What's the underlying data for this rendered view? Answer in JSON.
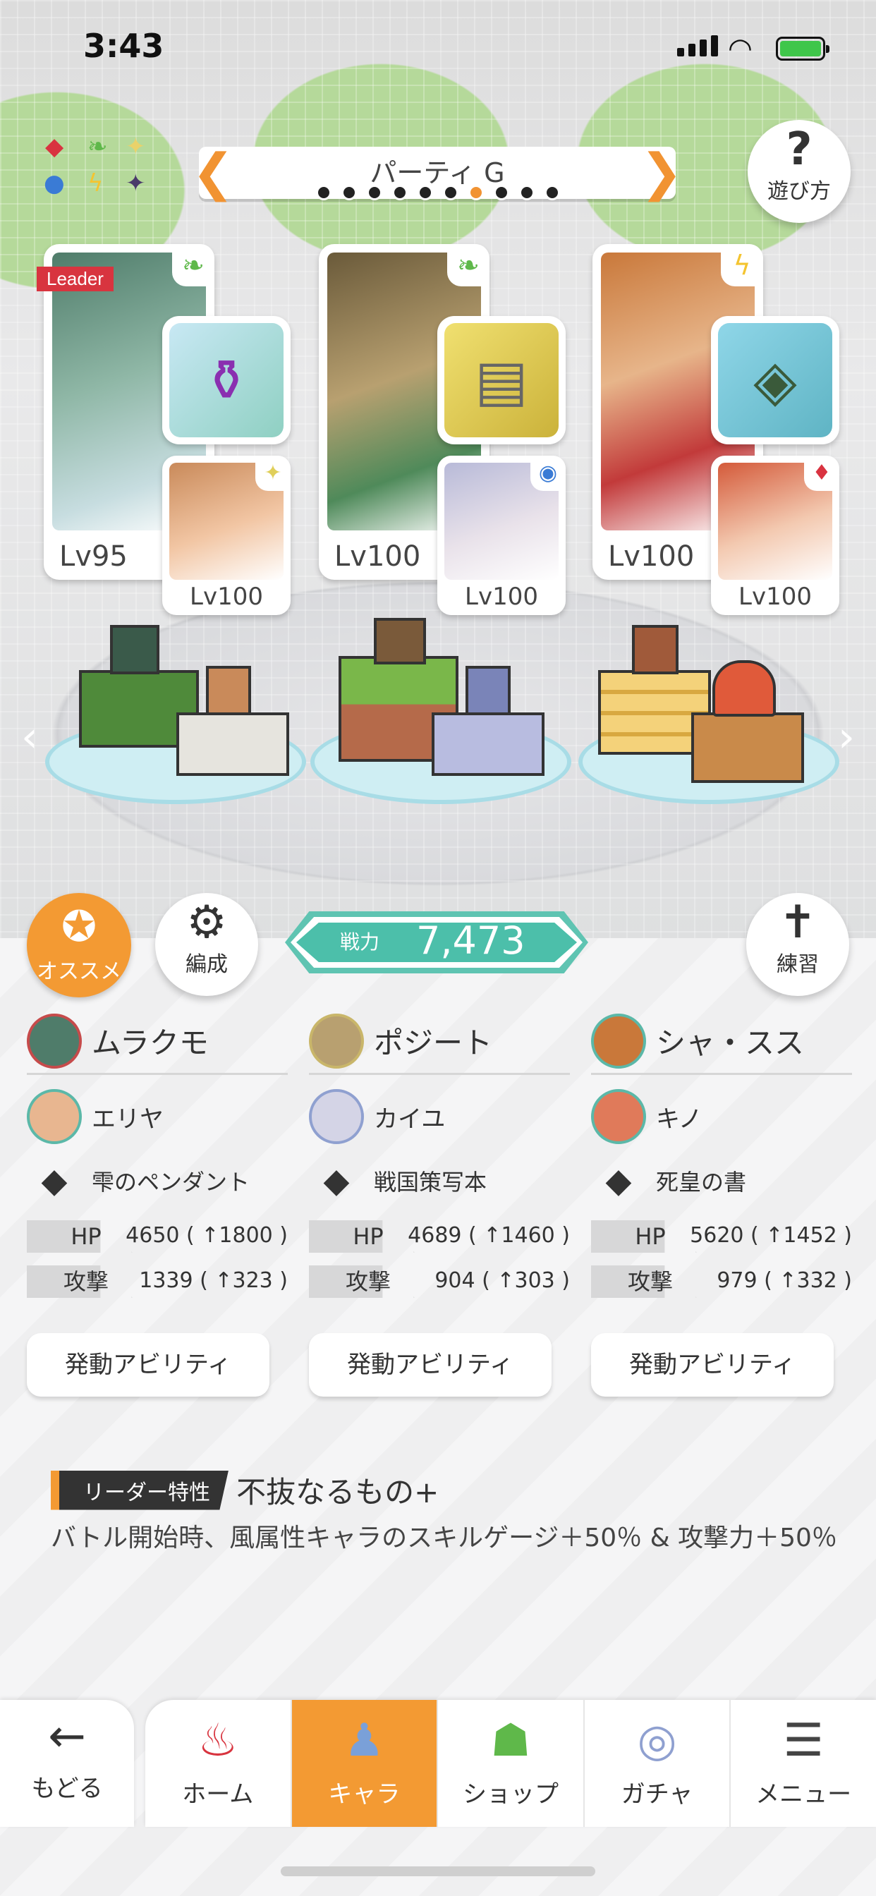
{
  "status_bar": {
    "time": "3:43"
  },
  "header": {
    "party_name": "パーティ G",
    "party_dot_count": 10,
    "party_active_index": 6,
    "help_label": "遊び方"
  },
  "lineup": {
    "leader_tag": "Leader",
    "slots": [
      {
        "main_level": "Lv95",
        "main_element_icon": "leaf-icon",
        "sub_level": "Lv100",
        "sub_element_icon": "sparkle-icon",
        "equip_icon": "potion-icon"
      },
      {
        "main_level": "Lv100",
        "main_element_icon": "leaf-icon",
        "sub_level": "Lv100",
        "sub_element_icon": "blue-orb-icon",
        "equip_icon": "scroll-icon"
      },
      {
        "main_level": "Lv100",
        "main_element_icon": "lightning-icon",
        "sub_level": "Lv100",
        "sub_element_icon": "red-diamonds-icon",
        "equip_icon": "book-icon"
      }
    ]
  },
  "controls": {
    "recommend_label": "オススメ",
    "formation_label": "編成",
    "practice_label": "練習",
    "power_label": "戦力",
    "power_value": "7,473"
  },
  "stats_labels": {
    "hp": "HP",
    "atk": "攻撃",
    "ability_button": "発動アビリティ"
  },
  "columns": [
    {
      "main_name": "ムラクモ",
      "sub_name": "エリヤ",
      "equip_name": "雫のペンダント",
      "hp": "4650 ( ↑1800 )",
      "atk": "1339 ( ↑323 )"
    },
    {
      "main_name": "ポジート",
      "sub_name": "カイユ",
      "equip_name": "戦国策写本",
      "hp": "4689 ( ↑1460 )",
      "atk": "904 ( ↑303 )"
    },
    {
      "main_name": "シャ・スス",
      "sub_name": "キノ",
      "equip_name": "死皇の書",
      "hp": "5620 ( ↑1452 )",
      "atk": "979 ( ↑332 )"
    }
  ],
  "leader_trait": {
    "tag": "リーダー特性",
    "name": "不抜なるもの+",
    "description": "バトル開始時、風属性キャラのスキルゲージ＋50％ & 攻撃力＋50％"
  },
  "bottom_nav": {
    "back_label": "もどる",
    "tabs": [
      {
        "label": "ホーム",
        "icon": "home-icon"
      },
      {
        "label": "キャラ",
        "icon": "chara-icon",
        "active": true
      },
      {
        "label": "ショップ",
        "icon": "shop-icon"
      },
      {
        "label": "ガチャ",
        "icon": "gacha-icon"
      },
      {
        "label": "メニュー",
        "icon": "menu-icon"
      }
    ]
  },
  "colors": {
    "accent_orange": "#f39a33",
    "power_teal": "#4cbfaa",
    "leader_red": "#d8343f"
  }
}
